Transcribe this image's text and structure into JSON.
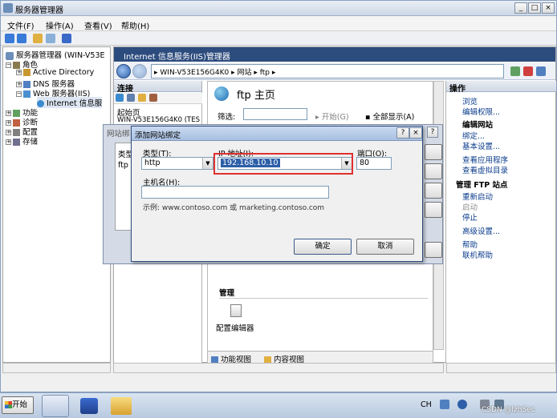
{
  "window": {
    "title": "服务器管理器"
  },
  "menu": [
    "文件(F)",
    "操作(A)",
    "查看(V)",
    "帮助(H)"
  ],
  "tree": {
    "root": "服务器管理器 (WIN-V53E",
    "roles": "角色",
    "ad": "Active Directory",
    "dns": "DNS 服务器",
    "web": "Web 服务器(IIS)",
    "iis_node": "Internet 信息服",
    "features": "功能",
    "diagnostics": "诊断",
    "config": "配置",
    "storage": "存储"
  },
  "iis": {
    "title": "Internet 信息服务(IIS)管理器",
    "breadcrumb": [
      "WIN-V53E156G4K0",
      "网站",
      "ftp"
    ],
    "connections_label": "连接",
    "conn_items": [
      "起始页",
      "WIN-V53E156G4K0 (TES"
    ],
    "page_title": "ftp 主页",
    "filter_label": "筛选:",
    "start_label": "开始(G)",
    "show_all_label": "全部显示(A)",
    "manage_group": "管理",
    "config_editor": "配置编辑器",
    "features_view": "功能视图",
    "content_view": "内容视图"
  },
  "actions": {
    "header": "操作",
    "browse": "浏览",
    "edit_perms": "编辑权限...",
    "edit_site": "编辑网站",
    "bind": "绑定...",
    "basic_settings": "基本设置...",
    "view_apps": "查看应用程序",
    "view_vdirs": "查看虚拟目录",
    "manage_ftp": "管理 FTP 站点",
    "restart": "重新启动",
    "start": "启动",
    "stop": "停止",
    "advanced": "高级设置...",
    "help": "帮助",
    "online_help": "联机帮助"
  },
  "bg_dialog": {
    "title": "网站绑",
    "col_type": "类型",
    "row_type": "ftp"
  },
  "dialog": {
    "title": "添加网站绑定",
    "type_label": "类型(T):",
    "type_value": "http",
    "ip_label": "IP 地址(I):",
    "ip_value": "192.168.10.10",
    "port_label": "端口(O):",
    "port_value": "80",
    "host_label": "主机名(H):",
    "host_value": "",
    "example": "示例: www.contoso.com 或 marketing.contoso.com",
    "ok": "确定",
    "cancel": "取消",
    "help_btn": "?",
    "close_btn": "×"
  },
  "taskbar": {
    "start": "开始",
    "lang": "CH",
    "watermark": "CSDN @lzhSec"
  }
}
